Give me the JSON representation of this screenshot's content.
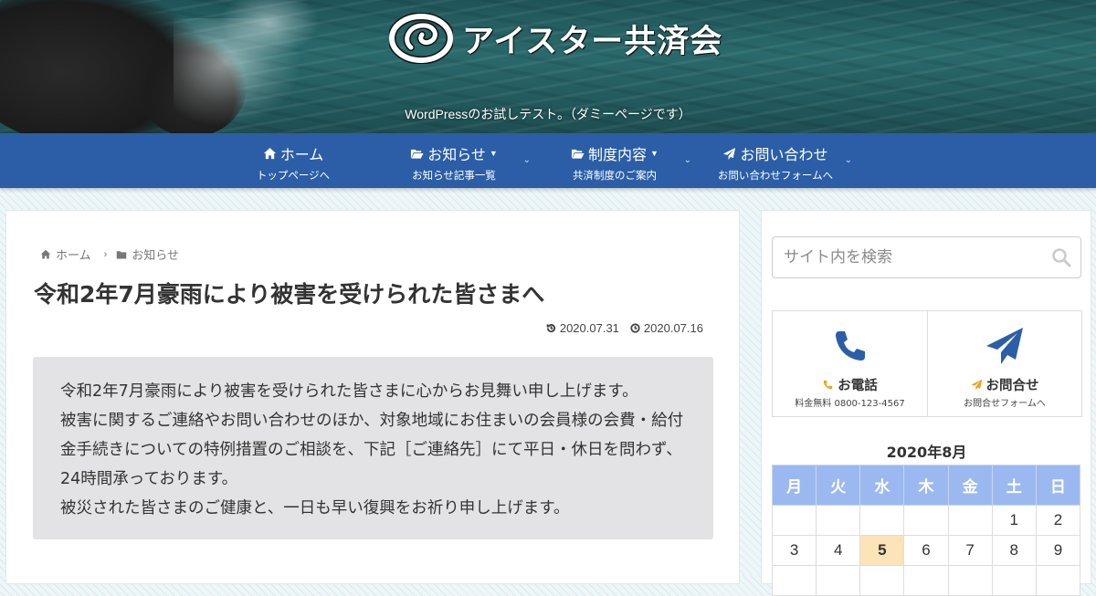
{
  "site": {
    "logo_text": "アイスター共済会",
    "tagline": "WordPressのお試しテスト。（ダミーページです）"
  },
  "nav": {
    "items": [
      {
        "label": "ホーム",
        "sub": "トップページへ",
        "icon": "home-icon",
        "has_caret": false
      },
      {
        "label": "お知らせ",
        "sub": "お知らせ記事一覧",
        "icon": "folder-open-icon",
        "has_caret": true
      },
      {
        "label": "制度内容",
        "sub": "共済制度のご案内",
        "icon": "folder-open-icon",
        "has_caret": true
      },
      {
        "label": "お問い合わせ",
        "sub": "お問い合わせフォームへ",
        "icon": "paper-plane-icon",
        "has_caret": false
      }
    ],
    "chevron": "⌄"
  },
  "breadcrumb": {
    "home": "ホーム",
    "category": "お知らせ",
    "separator": "›"
  },
  "article": {
    "title": "令和2年7月豪雨により被害を受けられた皆さまへ",
    "updated_date": "2020.07.31",
    "published_date": "2020.07.16",
    "paragraphs": [
      "令和2年7月豪雨により被害を受けられた皆さまに心からお見舞い申し上げます。",
      "被害に関するご連絡やお問い合わせのほか、対象地域にお住まいの会員様の会費・給付金手続きについての特例措置のご相談を、下記［ご連絡先］にて平日・休日を問わず、24時間承っております。",
      "被災された皆さまのご健康と、一日も早い復興をお祈り申し上げます。"
    ]
  },
  "sidebar": {
    "search_placeholder": "サイト内を検索",
    "contact": {
      "phone_title": "お電話",
      "phone_sub": "料金無料 0800-123-4567",
      "mail_title": "お問合せ",
      "mail_sub": "お問合せフォームへ"
    },
    "calendar": {
      "caption": "2020年8月",
      "weekdays": [
        "月",
        "火",
        "水",
        "木",
        "金",
        "土",
        "日"
      ],
      "rows": [
        [
          "",
          "",
          "",
          "",
          "",
          "1",
          "2"
        ],
        [
          "3",
          "4",
          "5",
          "6",
          "7",
          "8",
          "9"
        ],
        [
          "",
          "",
          "",
          "",
          "",
          "",
          ""
        ]
      ],
      "today": "5"
    }
  },
  "colors": {
    "nav_bg": "#2b5ea6",
    "accent_orange": "#f0a017",
    "calendar_header": "#9bb9f0",
    "today_bg": "#fde3b8"
  }
}
